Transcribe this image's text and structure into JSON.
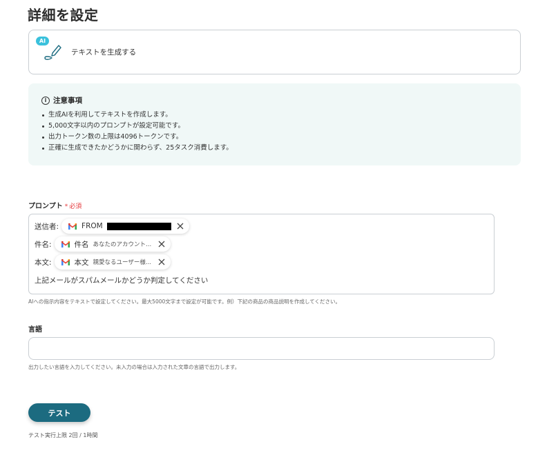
{
  "page": {
    "title": "詳細を設定"
  },
  "action": {
    "badge": "AI",
    "label": "テキストを生成する"
  },
  "notice": {
    "title": "注意事項",
    "items": [
      "生成AIを利用してテキストを作成します。",
      "5,000文字以内のプロンプトが設定可能です。",
      "出力トークン数の上限は4096トークンです。",
      "正確に生成できたかどうかに関わらず、25タスク消費します。"
    ]
  },
  "prompt": {
    "label": "プロンプト",
    "required": "必須",
    "rows": [
      {
        "label": "送信者:",
        "chip_name": "FROM",
        "chip_value": ""
      },
      {
        "label": "件名:",
        "chip_name": "件名",
        "chip_value": "あなたのアカウント..."
      },
      {
        "label": "本文:",
        "chip_name": "本文",
        "chip_value": "親愛なるユーザー様..."
      }
    ],
    "text": "上記メールがスパムメールかどうか判定してください",
    "help": "AIへの指示内容をテキストで設定してください。最大5000文字まで設定が可能です。例）下記の商品の商品説明を作成してください。"
  },
  "language": {
    "label": "言語",
    "value": "",
    "help": "出力したい言語を入力してください。未入力の場合は入力された文章の言語で出力します。"
  },
  "test": {
    "button_label": "テスト",
    "limit": "テスト実行上限 2回 / 1時間"
  },
  "colors": {
    "accent": "#1c6b80",
    "ai_badge": "#3ac1dc",
    "notice_bg": "#f0f8f7",
    "required": "#e5383b"
  }
}
